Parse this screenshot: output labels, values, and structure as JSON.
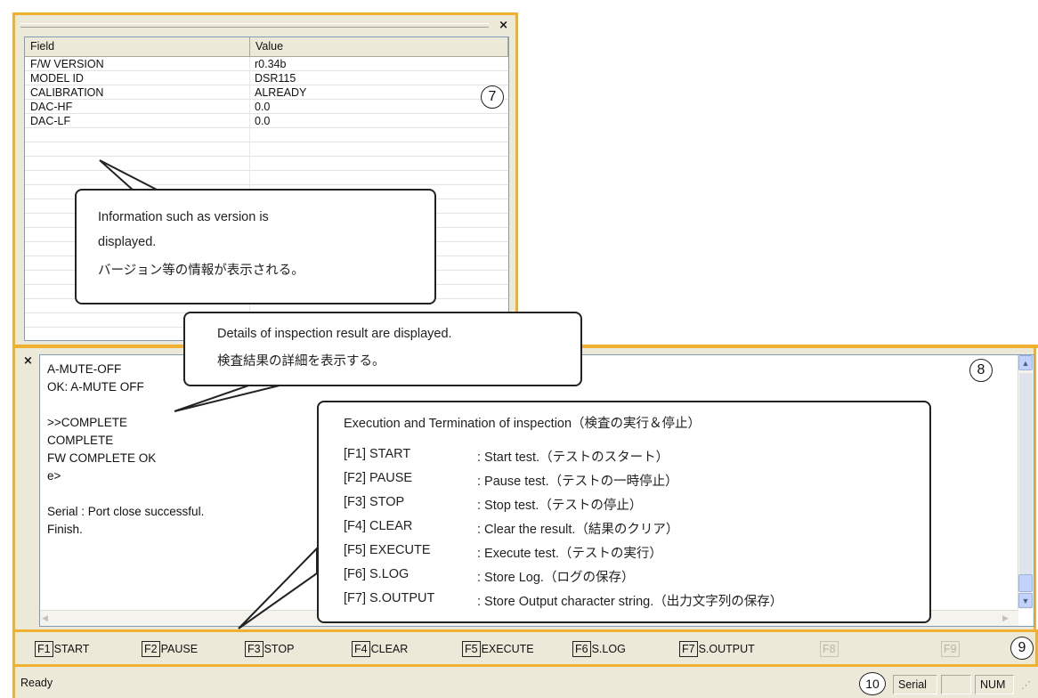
{
  "properties": {
    "columns": [
      "Field",
      "Value"
    ],
    "rows": [
      {
        "field": "F/W VERSION",
        "value": "r0.34b"
      },
      {
        "field": "MODEL ID",
        "value": "DSR115"
      },
      {
        "field": "CALIBRATION",
        "value": "ALREADY"
      },
      {
        "field": "DAC-HF",
        "value": "0.0"
      },
      {
        "field": "DAC-LF",
        "value": "0.0"
      }
    ],
    "close_glyph": "×"
  },
  "log": {
    "close_glyph": "×",
    "text": "A-MUTE-OFF\nOK: A-MUTE OFF\n\n>>COMPLETE\nCOMPLETE\nFW COMPLETE OK\ne>\n\nSerial : Port close successful.\nFinish."
  },
  "markers": {
    "m7": "7",
    "m8": "8",
    "m9": "9",
    "m10": "10"
  },
  "callouts": {
    "version": {
      "line1": "Information such as version is",
      "line2": "displayed.",
      "line3": "バージョン等の情報が表示される。"
    },
    "details": {
      "line1": "Details of inspection result are displayed.",
      "line2": "検査結果の詳細を表示する。"
    },
    "execution": {
      "title": "Execution and Termination of inspection（検査の実行＆停止）",
      "items": [
        {
          "key": "[F1] START",
          "desc": ": Start test.（テストのスタート）"
        },
        {
          "key": "[F2] PAUSE",
          "desc": ": Pause test.（テストの一時停止）"
        },
        {
          "key": "[F3] STOP",
          "desc": ": Stop test.（テストの停止）"
        },
        {
          "key": "[F4] CLEAR",
          "desc": ": Clear the result.（結果のクリア）"
        },
        {
          "key": "[F5] EXECUTE",
          "desc": ": Execute test.（テストの実行）"
        },
        {
          "key": "[F6] S.LOG",
          "desc": ": Store Log.（ログの保存）"
        },
        {
          "key": "[F7] S.OUTPUT",
          "desc": ": Store Output character string.（出力文字列の保存）"
        }
      ]
    }
  },
  "fkeys": [
    {
      "num": "F1",
      "label": "START"
    },
    {
      "num": "F2",
      "label": "PAUSE"
    },
    {
      "num": "F3",
      "label": "STOP"
    },
    {
      "num": "F4",
      "label": "CLEAR"
    },
    {
      "num": "F5",
      "label": "EXECUTE"
    },
    {
      "num": "F6",
      "label": "S.LOG"
    },
    {
      "num": "F7",
      "label": "S.OUTPUT"
    },
    {
      "num": "F8",
      "label": ""
    },
    {
      "num": "F9",
      "label": ""
    }
  ],
  "status": {
    "ready": "Ready",
    "serial": "Serial",
    "num": "NUM"
  },
  "colors": {
    "panel_border": "#f0b030",
    "face": "#ece9d8",
    "scroll_button": "#c1d3fb"
  }
}
